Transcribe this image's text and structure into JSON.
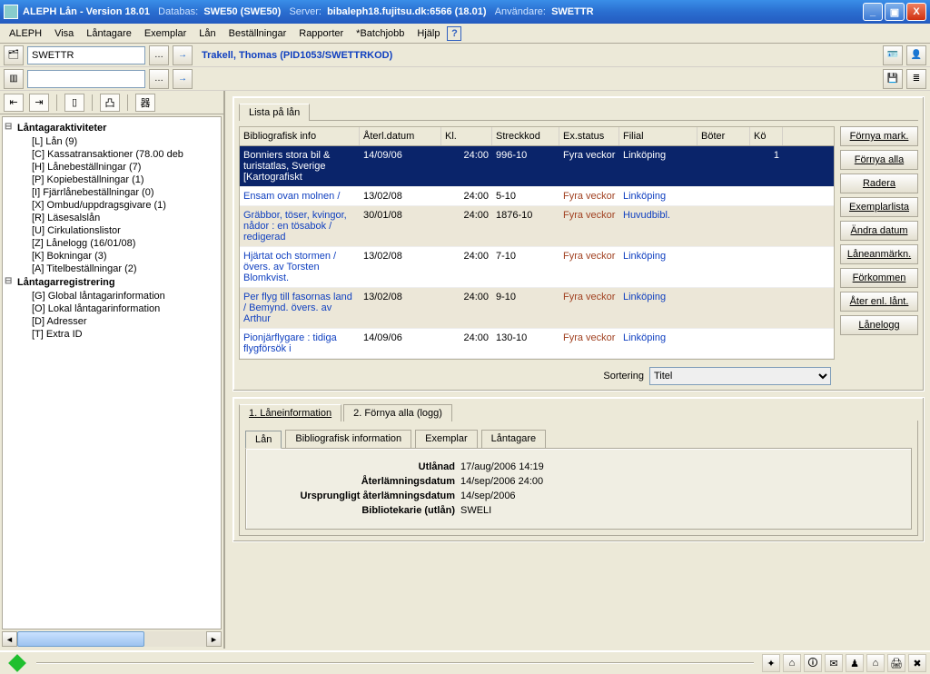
{
  "window_title": {
    "app": "ALEPH Lån - Version 18.01",
    "db_label": "Databas:",
    "db": "SWE50 (SWE50)",
    "srv_label": "Server:",
    "srv": "bibaleph18.fujitsu.dk:6566 (18.01)",
    "user_label": "Användare:",
    "user": "SWETTR"
  },
  "menu": [
    "ALEPH",
    "Visa",
    "Låntagare",
    "Exemplar",
    "Lån",
    "Beställningar",
    "Rapporter",
    "*Batchjobb",
    "Hjälp"
  ],
  "toolbar": {
    "user_code": "SWETTR",
    "patron": "Trakell, Thomas (PID1053/SWETTRKOD)"
  },
  "tree": {
    "root1": "Låntagaraktiviteter",
    "items1": [
      "[L] Lån (9)",
      "[C] Kassatransaktioner (78.00 deb",
      "[H] Lånebeställningar (7)",
      "[P] Kopiebeställningar (1)",
      "[I] Fjärrlånebeställningar (0)",
      "[X] Ombud/uppdragsgivare (1)",
      "[R] Läsesalslån",
      "[U] Cirkulationslistor",
      "[Z] Lånelogg (16/01/08)",
      "[K] Bokningar (3)",
      "[A] Titelbeställningar (2)"
    ],
    "root2": "Låntagarregistrering",
    "items2": [
      "[G] Global låntagarinformation",
      "[O] Lokal låntagarinformation",
      "[D] Adresser",
      "[T] Extra ID"
    ]
  },
  "top_tab": "Lista på lån",
  "columns": [
    "Bibliografisk info",
    "Återl.datum",
    "Kl.",
    "Streckkod",
    "Ex.status",
    "Filial",
    "Böter",
    "Kö"
  ],
  "rows": [
    {
      "title": "Bonniers stora bil & turistatlas, Sverige [Kartografiskt",
      "date": "14/09/06",
      "time": "24:00",
      "bar": "996-10",
      "status": "Fyra veckor",
      "branch": "Linköping",
      "fine": "",
      "queue": "1",
      "sel": true,
      "dark": true
    },
    {
      "title": "Ensam ovan molnen /",
      "date": "13/02/08",
      "time": "24:00",
      "bar": "5-10",
      "status": "Fyra veckor",
      "branch": "Linköping",
      "fine": "",
      "queue": ""
    },
    {
      "title": "Gräbbor, töser, kvingor, nådor : en tösabok / redigerad",
      "date": "30/01/08",
      "time": "24:00",
      "bar": "1876-10",
      "status": "Fyra veckor",
      "branch": "Huvudbibl.",
      "fine": "",
      "queue": "",
      "dark": true
    },
    {
      "title": "Hjärtat och stormen / övers. av Torsten Blomkvist.",
      "date": "13/02/08",
      "time": "24:00",
      "bar": "7-10",
      "status": "Fyra veckor",
      "branch": "Linköping",
      "fine": "",
      "queue": ""
    },
    {
      "title": "Per flyg till fasornas land / Bemynd. övers. av Arthur",
      "date": "13/02/08",
      "time": "24:00",
      "bar": "9-10",
      "status": "Fyra veckor",
      "branch": "Linköping",
      "fine": "",
      "queue": "",
      "dark": true
    },
    {
      "title": "Pionjärflygare : tidiga flygförsök i",
      "date": "14/09/06",
      "time": "24:00",
      "bar": "130-10",
      "status": "Fyra veckor",
      "branch": "Linköping",
      "fine": "",
      "queue": ""
    }
  ],
  "actions": [
    "Förnya mark.",
    "Förnya alla",
    "Radera",
    "Exemplarlista",
    "Ändra datum",
    "Låneanmärkn.",
    "Förkommen",
    "Åter enl. lånt.",
    "Lånelogg"
  ],
  "sort_label": "Sortering",
  "sort_value": "Titel",
  "lower_tabs": [
    "1. Låneinformation",
    "2. Förnya alla (logg)"
  ],
  "info_tabs": [
    "Lån",
    "Bibliografisk information",
    "Exemplar",
    "Låntagare"
  ],
  "info": {
    "l1": "Utlånad",
    "v1": "17/aug/2006 14:19",
    "l2": "Återlämningsdatum",
    "v2": "14/sep/2006 24:00",
    "l3": "Ursprungligt återlämningsdatum",
    "v3": "14/sep/2006",
    "l4": "Bibliotekarie (utlån)",
    "v4": "SWELI"
  }
}
